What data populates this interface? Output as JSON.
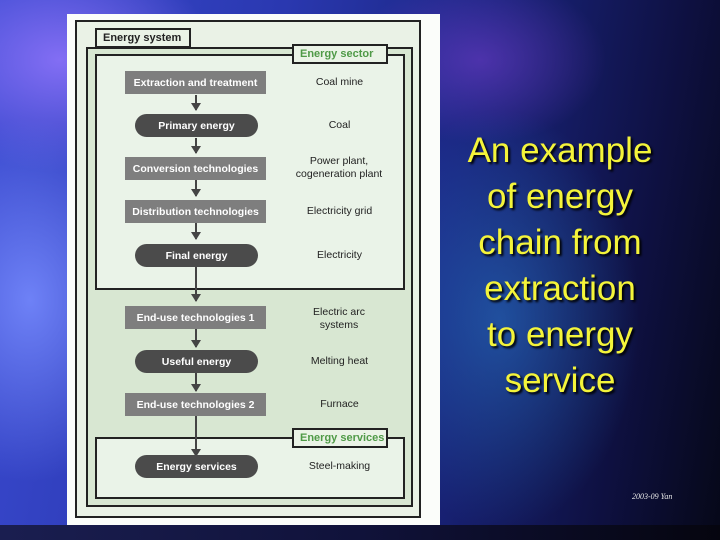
{
  "slide": {
    "title_lines": [
      "An example",
      "of energy",
      "chain from",
      "extraction",
      "to energy",
      "service"
    ],
    "footer": "2003-09 Yan",
    "title_color": "#f4f43a"
  },
  "diagram": {
    "system_label": "Energy system",
    "sector_label": "Energy sector",
    "services_label": "Energy services",
    "label_green": "#4f9a47",
    "chain": [
      {
        "stage": "Extraction and treatment",
        "shape": "rect",
        "example": "Coal mine"
      },
      {
        "stage": "Primary energy",
        "shape": "pill",
        "example": "Coal"
      },
      {
        "stage": "Conversion technologies",
        "shape": "rect",
        "example": "Power plant, cogeneration plant"
      },
      {
        "stage": "Distribution technologies",
        "shape": "rect",
        "example": "Electricity grid"
      },
      {
        "stage": "Final energy",
        "shape": "pill",
        "example": "Electricity"
      },
      {
        "stage": "End-use technologies 1",
        "shape": "rect",
        "example": "Electric arc systems"
      },
      {
        "stage": "Useful energy",
        "shape": "pill",
        "example": "Melting heat"
      },
      {
        "stage": "End-use technologies 2",
        "shape": "rect",
        "example": "Furnace"
      },
      {
        "stage": "Energy services",
        "shape": "pill",
        "example": "Steel-making"
      }
    ]
  }
}
